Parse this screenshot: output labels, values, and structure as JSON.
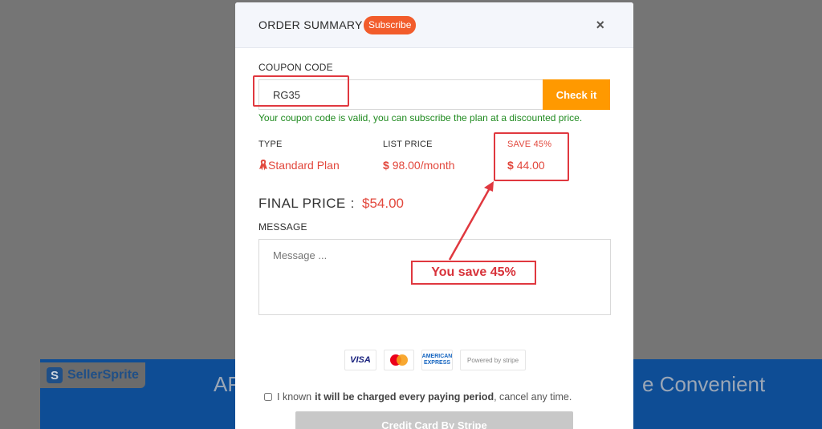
{
  "background": {
    "logo_text": "SellerSprite",
    "left_text": "AP",
    "right_text": "e Convenient"
  },
  "modal": {
    "title": "ORDER SUMMARY",
    "badge": "Subscribe",
    "close_icon": "×"
  },
  "coupon": {
    "label": "COUPON CODE",
    "value": "RG35",
    "button": "Check it",
    "valid_message": "Your coupon code is valid, you can subscribe the plan at a discounted price."
  },
  "plan": {
    "type_header": "TYPE",
    "type_value": "Standard Plan",
    "list_price_header": "LIST PRICE",
    "list_price_symbol": "$",
    "list_price_value": "98.00/month",
    "save_header": "SAVE 45%",
    "save_symbol": "$",
    "save_value": "44.00"
  },
  "final": {
    "label": "FINAL PRICE",
    "colon": ":",
    "value": "$54.00"
  },
  "message": {
    "label": "MESSAGE",
    "placeholder": "Message ..."
  },
  "annotation": {
    "callout": "You save 45%"
  },
  "payment": {
    "visa": "VISA",
    "amex_line1": "AMERICAN",
    "amex_line2": "EXPRESS",
    "stripe": "Powered by stripe"
  },
  "terms": {
    "prefix": "I known",
    "bold": "it will be charged every paying period",
    "suffix": ", cancel any time."
  },
  "submit": {
    "label": "Credit Card By Stripe"
  },
  "colors": {
    "accent_orange": "#ff9900",
    "badge": "#f25c2b",
    "price_red": "#e2483d",
    "highlight_red": "#e0383f",
    "valid_green": "#1f8a1f"
  }
}
